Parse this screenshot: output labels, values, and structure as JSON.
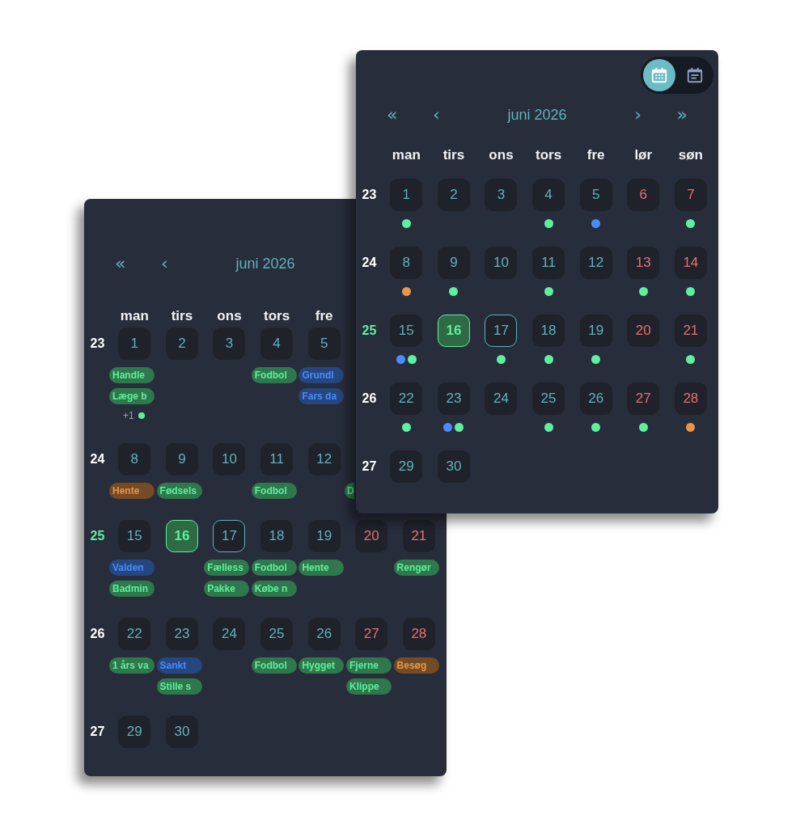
{
  "event_calendar": {
    "nav": [
      "«",
      "‹"
    ],
    "title": "juni 2026",
    "weekdays": [
      "man",
      "tirs",
      "ons",
      "tors",
      "fre"
    ],
    "weeks": [
      {
        "number": "23",
        "current": false,
        "days": [
          {
            "day": "1",
            "weekend": false,
            "today": false,
            "selected": false,
            "events": [
              {
                "title": "Handle",
                "color": "#2f784d"
              },
              {
                "title": "Læge b",
                "color": "#2f784d"
              }
            ],
            "more": {
              "label": "+1",
              "color": "#5ef0a0"
            }
          },
          {
            "day": "2",
            "weekend": false,
            "today": false,
            "selected": false
          },
          {
            "day": "3",
            "weekend": false,
            "today": false,
            "selected": false
          },
          {
            "day": "4",
            "weekend": false,
            "today": false,
            "selected": false,
            "events": [
              {
                "title": "Fodbol",
                "color": "#2f784d"
              }
            ]
          },
          {
            "day": "5",
            "weekend": false,
            "today": false,
            "selected": false,
            "events": [
              {
                "title": "Grundl",
                "color": "#25467f"
              },
              {
                "title": "Fars da",
                "color": "#25467f"
              }
            ]
          }
        ]
      },
      {
        "number": "24",
        "current": false,
        "days": [
          {
            "day": "8",
            "weekend": false,
            "today": false,
            "selected": false,
            "events": [
              {
                "title": "Hente",
                "color": "#744b25"
              }
            ]
          },
          {
            "day": "9",
            "weekend": false,
            "today": false,
            "selected": false,
            "events": [
              {
                "title": "Fødsels",
                "color": "#2f784d"
              }
            ]
          },
          {
            "day": "10",
            "weekend": false,
            "today": false,
            "selected": false
          },
          {
            "day": "11",
            "weekend": false,
            "today": false,
            "selected": false,
            "events": [
              {
                "title": "Fodbol",
                "color": "#2f784d"
              }
            ]
          },
          {
            "day": "12",
            "weekend": false,
            "today": false,
            "selected": false
          },
          {
            "events": [
              {
                "title": "D",
                "color": "#2f784d"
              }
            ]
          }
        ]
      },
      {
        "number": "25",
        "current": true,
        "days": [
          {
            "day": "15",
            "weekend": false,
            "today": false,
            "selected": false,
            "events": [
              {
                "title": "Valden",
                "color": "#25467f"
              },
              {
                "title": "Badmin",
                "color": "#2f784d"
              }
            ]
          },
          {
            "day": "16",
            "weekend": false,
            "today": true,
            "selected": false
          },
          {
            "day": "17",
            "weekend": false,
            "today": false,
            "selected": true,
            "events": [
              {
                "title": "Fælless",
                "color": "#2f784d"
              },
              {
                "title": "Pakke",
                "color": "#2f784d"
              }
            ]
          },
          {
            "day": "18",
            "weekend": false,
            "today": false,
            "selected": false,
            "events": [
              {
                "title": "Fodbol",
                "color": "#2f784d"
              },
              {
                "title": "Købe n",
                "color": "#2f784d"
              }
            ]
          },
          {
            "day": "19",
            "weekend": false,
            "today": false,
            "selected": false,
            "events": [
              {
                "title": "Hente",
                "color": "#2f784d"
              }
            ]
          },
          {
            "day": "20",
            "weekend": true,
            "today": false,
            "selected": false
          },
          {
            "day": "21",
            "weekend": true,
            "today": false,
            "selected": false,
            "events": [
              {
                "title": "Rengør",
                "color": "#2f784d"
              }
            ]
          }
        ]
      },
      {
        "number": "26",
        "current": false,
        "days": [
          {
            "day": "22",
            "weekend": false,
            "today": false,
            "selected": false,
            "events": [
              {
                "title": "1 års va",
                "color": "#2f784d"
              }
            ]
          },
          {
            "day": "23",
            "weekend": false,
            "today": false,
            "selected": false,
            "events": [
              {
                "title": "Sankt",
                "color": "#25467f"
              },
              {
                "title": "Stille s",
                "color": "#2f784d"
              }
            ]
          },
          {
            "day": "24",
            "weekend": false,
            "today": false,
            "selected": false
          },
          {
            "day": "25",
            "weekend": false,
            "today": false,
            "selected": false,
            "events": [
              {
                "title": "Fodbol",
                "color": "#2f784d"
              }
            ]
          },
          {
            "day": "26",
            "weekend": false,
            "today": false,
            "selected": false,
            "events": [
              {
                "title": "Hygget",
                "color": "#2f784d"
              }
            ]
          },
          {
            "day": "27",
            "weekend": true,
            "today": false,
            "selected": false,
            "events": [
              {
                "title": "Fjerne",
                "color": "#2f784d"
              },
              {
                "title": "Klippe",
                "color": "#2f784d"
              }
            ]
          },
          {
            "day": "28",
            "weekend": true,
            "today": false,
            "selected": false,
            "events": [
              {
                "title": "Besøg",
                "color": "#744b25"
              }
            ]
          }
        ]
      },
      {
        "number": "27",
        "current": false,
        "days": [
          {
            "day": "29",
            "weekend": false,
            "today": false,
            "selected": false
          },
          {
            "day": "30",
            "weekend": false,
            "today": false,
            "selected": false
          }
        ]
      }
    ]
  },
  "dot_calendar": {
    "view_toggle": [
      {
        "kind": "month",
        "selected": true
      },
      {
        "kind": "agenda",
        "selected": false
      }
    ],
    "nav": [
      "«",
      "‹",
      "›",
      "»"
    ],
    "title": "juni 2026",
    "weekdays": [
      "man",
      "tirs",
      "ons",
      "tors",
      "fre",
      "lør",
      "søn"
    ],
    "weeks": [
      {
        "number": "23",
        "current": false,
        "days": [
          {
            "day": "1",
            "weekend": false,
            "today": false,
            "selected": false,
            "dots": [
              {
                "color": "#5ef0a0"
              }
            ]
          },
          {
            "day": "2",
            "weekend": false,
            "today": false,
            "selected": false
          },
          {
            "day": "3",
            "weekend": false,
            "today": false,
            "selected": false
          },
          {
            "day": "4",
            "weekend": false,
            "today": false,
            "selected": false,
            "dots": [
              {
                "color": "#5ef0a0"
              }
            ]
          },
          {
            "day": "5",
            "weekend": false,
            "today": false,
            "selected": false,
            "dots": [
              {
                "color": "#4a8cff"
              }
            ]
          },
          {
            "day": "6",
            "weekend": true,
            "today": false,
            "selected": false
          },
          {
            "day": "7",
            "weekend": true,
            "today": false,
            "selected": false,
            "dots": [
              {
                "color": "#5ef0a0"
              }
            ]
          }
        ]
      },
      {
        "number": "24",
        "current": false,
        "days": [
          {
            "day": "8",
            "weekend": false,
            "today": false,
            "selected": false,
            "dots": [
              {
                "color": "#e8974a"
              }
            ]
          },
          {
            "day": "9",
            "weekend": false,
            "today": false,
            "selected": false,
            "dots": [
              {
                "color": "#5ef0a0"
              }
            ]
          },
          {
            "day": "10",
            "weekend": false,
            "today": false,
            "selected": false
          },
          {
            "day": "11",
            "weekend": false,
            "today": false,
            "selected": false,
            "dots": [
              {
                "color": "#5ef0a0"
              }
            ]
          },
          {
            "day": "12",
            "weekend": false,
            "today": false,
            "selected": false
          },
          {
            "day": "13",
            "weekend": true,
            "today": false,
            "selected": false,
            "dots": [
              {
                "color": "#5ef0a0"
              }
            ]
          },
          {
            "day": "14",
            "weekend": true,
            "today": false,
            "selected": false,
            "dots": [
              {
                "color": "#5ef0a0"
              }
            ]
          }
        ]
      },
      {
        "number": "25",
        "current": true,
        "days": [
          {
            "day": "15",
            "weekend": false,
            "today": false,
            "selected": false,
            "dots": [
              {
                "color": "#4a8cff"
              },
              {
                "color": "#5ef0a0"
              }
            ]
          },
          {
            "day": "16",
            "weekend": false,
            "today": true,
            "selected": false
          },
          {
            "day": "17",
            "weekend": false,
            "today": false,
            "selected": true,
            "dots": [
              {
                "color": "#5ef0a0"
              }
            ]
          },
          {
            "day": "18",
            "weekend": false,
            "today": false,
            "selected": false,
            "dots": [
              {
                "color": "#5ef0a0"
              }
            ]
          },
          {
            "day": "19",
            "weekend": false,
            "today": false,
            "selected": false,
            "dots": [
              {
                "color": "#5ef0a0"
              }
            ]
          },
          {
            "day": "20",
            "weekend": true,
            "today": false,
            "selected": false
          },
          {
            "day": "21",
            "weekend": true,
            "today": false,
            "selected": false,
            "dots": [
              {
                "color": "#5ef0a0"
              }
            ]
          }
        ]
      },
      {
        "number": "26",
        "current": false,
        "days": [
          {
            "day": "22",
            "weekend": false,
            "today": false,
            "selected": false,
            "dots": [
              {
                "color": "#5ef0a0"
              }
            ]
          },
          {
            "day": "23",
            "weekend": false,
            "today": false,
            "selected": false,
            "dots": [
              {
                "color": "#4a8cff"
              },
              {
                "color": "#5ef0a0"
              }
            ]
          },
          {
            "day": "24",
            "weekend": false,
            "today": false,
            "selected": false
          },
          {
            "day": "25",
            "weekend": false,
            "today": false,
            "selected": false,
            "dots": [
              {
                "color": "#5ef0a0"
              }
            ]
          },
          {
            "day": "26",
            "weekend": false,
            "today": false,
            "selected": false,
            "dots": [
              {
                "color": "#5ef0a0"
              }
            ]
          },
          {
            "day": "27",
            "weekend": true,
            "today": false,
            "selected": false,
            "dots": [
              {
                "color": "#5ef0a0"
              }
            ]
          },
          {
            "day": "28",
            "weekend": true,
            "today": false,
            "selected": false,
            "dots": [
              {
                "color": "#e8974a"
              }
            ]
          }
        ]
      },
      {
        "number": "27",
        "current": false,
        "days": [
          {
            "day": "29",
            "weekend": false,
            "today": false,
            "selected": false
          },
          {
            "day": "30",
            "weekend": false,
            "today": false,
            "selected": false
          }
        ]
      }
    ]
  }
}
